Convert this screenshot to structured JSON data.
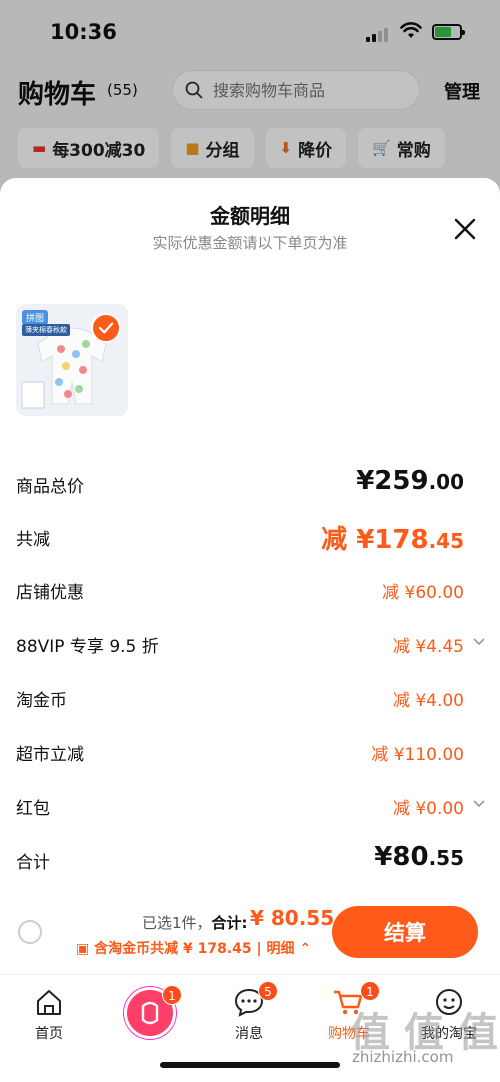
{
  "status_bar": {
    "time": "10:36"
  },
  "cart": {
    "title": "购物车",
    "count": "(55)",
    "search_placeholder": "搜索购物车商品",
    "manage": "管理",
    "chips": [
      {
        "icon": "coupon-icon",
        "label": "每300减30"
      },
      {
        "icon": "folder-icon",
        "label": "分组"
      },
      {
        "icon": "price-down-icon",
        "label": "降价"
      },
      {
        "icon": "cart-icon",
        "label": "常购"
      }
    ]
  },
  "sheet": {
    "title": "金额明细",
    "subtitle": "实际优惠金额请以下单页为准",
    "product": {
      "tag": "拼图",
      "subtag": "薄夹棉春秋款"
    },
    "rows": [
      {
        "label": "商品总价",
        "value_main": "¥259",
        "value_dec": ".00",
        "style": "total"
      },
      {
        "label": "共减",
        "value_main": "减 ¥178",
        "value_dec": ".45",
        "style": "discount-total"
      },
      {
        "label": "店铺优惠",
        "value": "减 ¥60.00"
      },
      {
        "label": "88VIP 专享 9.5 折",
        "value": "减 ¥4.45",
        "expandable": true
      },
      {
        "label": "淘金币",
        "value": "减 ¥4.00"
      },
      {
        "label": "超市立减",
        "value": "减 ¥110.00"
      },
      {
        "label": "红包",
        "value": "减 ¥0.00",
        "expandable": true
      },
      {
        "label": "合计",
        "value_main": "¥80",
        "value_dec": ".55",
        "style": "total"
      }
    ]
  },
  "checkout": {
    "selected": "已选1件，",
    "total_label": "合计:",
    "total_value": "¥ 80.55",
    "savings": "含淘金币共减 ¥ 178.45 | 明细",
    "pay_button": "结算"
  },
  "tabbar": {
    "tabs": [
      {
        "label": "首页",
        "icon": "home-icon"
      },
      {
        "label": "",
        "icon": "taobao-logo-icon",
        "badge": "1"
      },
      {
        "label": "消息",
        "icon": "message-icon",
        "badge": "5"
      },
      {
        "label": "购物车",
        "icon": "cart-icon",
        "badge": "1",
        "active": true
      },
      {
        "label": "我的淘宝",
        "icon": "profile-icon"
      }
    ]
  },
  "watermark": {
    "text": "值 值 值",
    "url": "zhizhizhi.com"
  },
  "colors": {
    "accent": "#ff5a1a",
    "active_tab": "#ff5a1a"
  }
}
